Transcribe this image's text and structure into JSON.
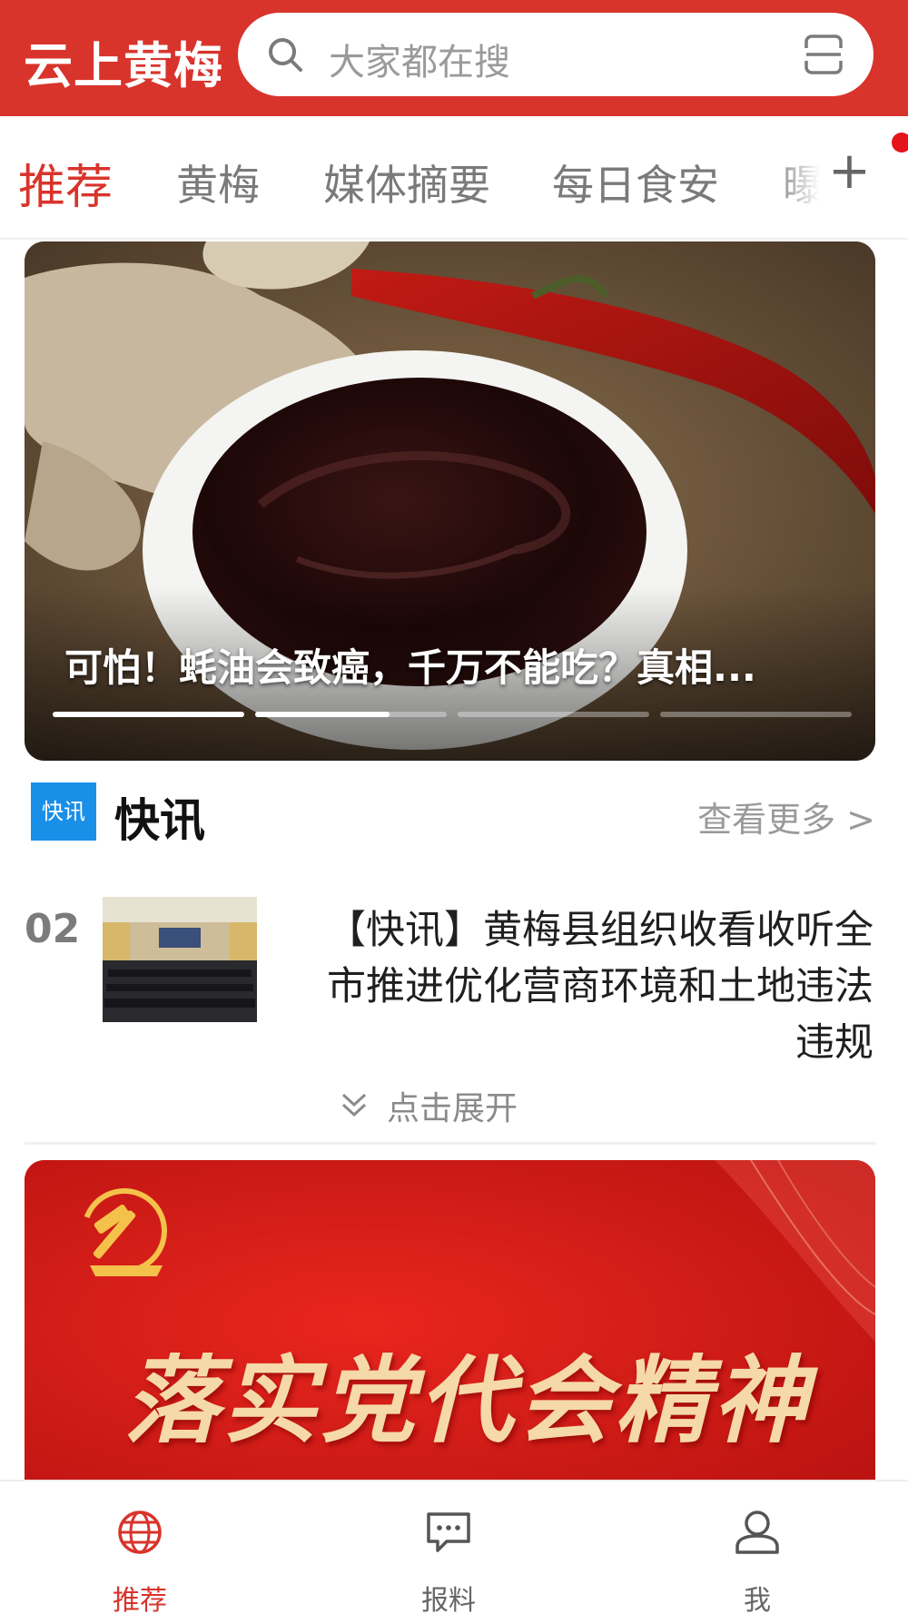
{
  "header": {
    "app_title": "云上黄梅",
    "search_placeholder": "大家都在搜"
  },
  "tabs": [
    {
      "label": "推荐",
      "active": true
    },
    {
      "label": "黄梅",
      "active": false
    },
    {
      "label": "媒体摘要",
      "active": false
    },
    {
      "label": "每日食安",
      "active": false
    },
    {
      "label": "曝",
      "active": false
    }
  ],
  "tabs_add_label": "+",
  "carousel": {
    "caption": "可怕！蚝油会致癌，千万不能吃？真相...",
    "slide_count": 4,
    "progress": [
      1.0,
      0.7,
      0,
      0
    ]
  },
  "kuaixun": {
    "badge": "快讯",
    "title": "快讯",
    "more": "查看更多 >",
    "item": {
      "number": "02",
      "text": "【快讯】黄梅县组织收看收听全市推进优化营商环境和土地违法违规"
    },
    "expand": "点击展开"
  },
  "banner": {
    "text": "落实党代会精神"
  },
  "bottom_nav": [
    {
      "label": "推荐",
      "icon": "globe-icon",
      "active": true
    },
    {
      "label": "报料",
      "icon": "chat-icon",
      "active": false
    },
    {
      "label": "我",
      "icon": "user-icon",
      "active": false
    }
  ],
  "colors": {
    "brand_red": "#d8342c",
    "badge_blue": "#1a8fe8"
  }
}
